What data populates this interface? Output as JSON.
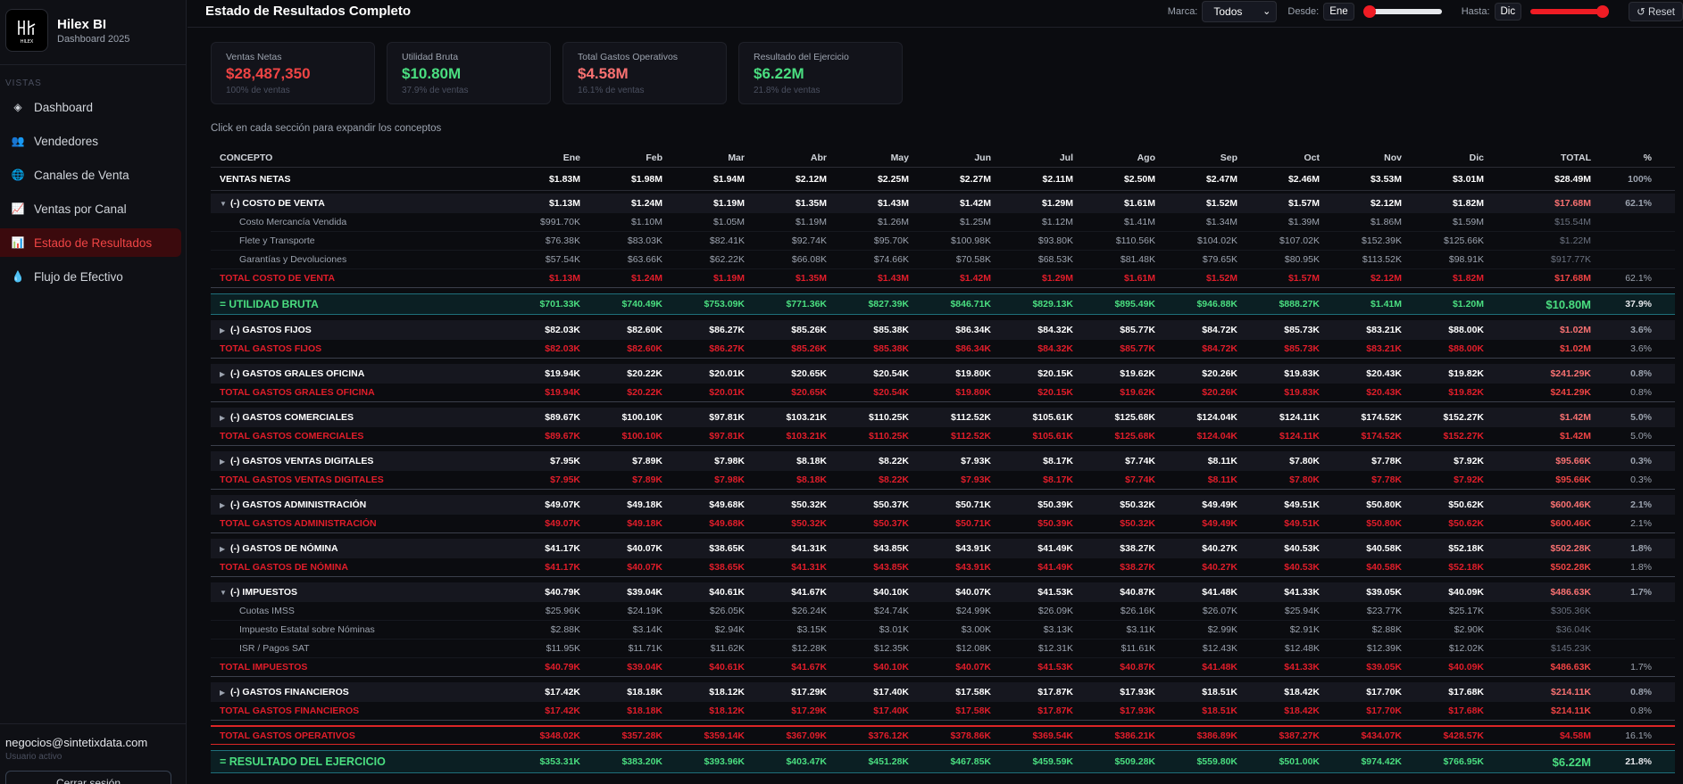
{
  "colors": {
    "accent": "#ef4444",
    "positive": "#4ade80",
    "active_bg": "#3b0a0d"
  },
  "sidebar": {
    "brand_title": "Hilex BI",
    "brand_subtitle": "Dashboard 2025",
    "logo_text": "HILEX",
    "section_label": "VISTAS",
    "items": [
      {
        "label": "Dashboard",
        "icon": "diamond-icon"
      },
      {
        "label": "Vendedores",
        "icon": "users-icon"
      },
      {
        "label": "Canales de Venta",
        "icon": "globe-icon"
      },
      {
        "label": "Ventas por Canal",
        "icon": "trend-chart-icon"
      },
      {
        "label": "Estado de Resultados",
        "icon": "bar-chart-icon",
        "active": true
      },
      {
        "label": "Flujo de Efectivo",
        "icon": "droplet-icon"
      }
    ],
    "user_email": "negocios@sintetixdata.com",
    "user_status": "Usuario activo",
    "logout_label": "Cerrar sesión"
  },
  "header": {
    "title": "Estado de Resultados Completo",
    "marca_label": "Marca:",
    "marca_value": "Todos",
    "desde_label": "Desde:",
    "desde_value": "Ene",
    "hasta_label": "Hasta:",
    "hasta_value": "Dic",
    "desde_slider_value": 0,
    "hasta_slider_value": 1,
    "reset_label": "↺ Reset"
  },
  "kpis": [
    {
      "label": "Ventas Netas",
      "value": "$28,487,350",
      "sub": "100% de ventas",
      "color": "#ef4444"
    },
    {
      "label": "Utilidad Bruta",
      "value": "$10.80M",
      "sub": "37.9% de ventas",
      "color": "#4ade80"
    },
    {
      "label": "Total Gastos Operativos",
      "value": "$4.58M",
      "sub": "16.1% de ventas",
      "color": "#f87171"
    },
    {
      "label": "Resultado del Ejercicio",
      "value": "$6.22M",
      "sub": "21.8% de ventas",
      "color": "#4ade80"
    }
  ],
  "hint": "Click en cada sección para expandir los conceptos",
  "table": {
    "headers": [
      "CONCEPTO",
      "Ene",
      "Feb",
      "Mar",
      "Abr",
      "May",
      "Jun",
      "Jul",
      "Ago",
      "Sep",
      "Oct",
      "Nov",
      "Dic",
      "TOTAL",
      "%"
    ],
    "rows": [
      {
        "type": "ventas",
        "label": "VENTAS NETAS",
        "values": [
          "$1.83M",
          "$1.98M",
          "$1.94M",
          "$2.12M",
          "$2.25M",
          "$2.27M",
          "$2.11M",
          "$2.50M",
          "$2.47M",
          "$2.46M",
          "$3.53M",
          "$3.01M"
        ],
        "total": "$28.49M",
        "pct": "100%"
      },
      {
        "type": "sec",
        "expanded": true,
        "label": "(-) COSTO DE VENTA",
        "values": [
          "$1.13M",
          "$1.24M",
          "$1.19M",
          "$1.35M",
          "$1.43M",
          "$1.42M",
          "$1.29M",
          "$1.61M",
          "$1.52M",
          "$1.57M",
          "$2.12M",
          "$1.82M"
        ],
        "total": "$17.68M",
        "pct": "62.1%"
      },
      {
        "type": "detail",
        "label": "Costo Mercancía Vendida",
        "values": [
          "$991.70K",
          "$1.10M",
          "$1.05M",
          "$1.19M",
          "$1.26M",
          "$1.25M",
          "$1.12M",
          "$1.41M",
          "$1.34M",
          "$1.39M",
          "$1.86M",
          "$1.59M"
        ],
        "total": "$15.54M",
        "pct": ""
      },
      {
        "type": "detail",
        "label": "Flete y Transporte",
        "values": [
          "$76.38K",
          "$83.03K",
          "$82.41K",
          "$92.74K",
          "$95.70K",
          "$100.98K",
          "$93.80K",
          "$110.56K",
          "$104.02K",
          "$107.02K",
          "$152.39K",
          "$125.66K"
        ],
        "total": "$1.22M",
        "pct": ""
      },
      {
        "type": "detail",
        "label": "Garantías y Devoluciones",
        "values": [
          "$57.54K",
          "$63.66K",
          "$62.22K",
          "$66.08K",
          "$74.66K",
          "$70.58K",
          "$68.53K",
          "$81.48K",
          "$79.65K",
          "$80.95K",
          "$113.52K",
          "$98.91K"
        ],
        "total": "$917.77K",
        "pct": ""
      },
      {
        "type": "total",
        "label": "TOTAL COSTO DE VENTA",
        "values": [
          "$1.13M",
          "$1.24M",
          "$1.19M",
          "$1.35M",
          "$1.43M",
          "$1.42M",
          "$1.29M",
          "$1.61M",
          "$1.52M",
          "$1.57M",
          "$2.12M",
          "$1.82M"
        ],
        "total": "$17.68M",
        "pct": "62.1%"
      },
      {
        "type": "util",
        "label": "= UTILIDAD BRUTA",
        "values": [
          "$701.33K",
          "$740.49K",
          "$753.09K",
          "$771.36K",
          "$827.39K",
          "$846.71K",
          "$829.13K",
          "$895.49K",
          "$946.88K",
          "$888.27K",
          "$1.41M",
          "$1.20M"
        ],
        "total": "$10.80M",
        "pct": "37.9%"
      },
      {
        "type": "sec",
        "label": "(-) GASTOS FIJOS",
        "values": [
          "$82.03K",
          "$82.60K",
          "$86.27K",
          "$85.26K",
          "$85.38K",
          "$86.34K",
          "$84.32K",
          "$85.77K",
          "$84.72K",
          "$85.73K",
          "$83.21K",
          "$88.00K"
        ],
        "total": "$1.02M",
        "pct": "3.6%"
      },
      {
        "type": "total",
        "label": "TOTAL GASTOS FIJOS",
        "values": [
          "$82.03K",
          "$82.60K",
          "$86.27K",
          "$85.26K",
          "$85.38K",
          "$86.34K",
          "$84.32K",
          "$85.77K",
          "$84.72K",
          "$85.73K",
          "$83.21K",
          "$88.00K"
        ],
        "total": "$1.02M",
        "pct": "3.6%"
      },
      {
        "type": "sec",
        "label": "(-) GASTOS GRALES OFICINA",
        "values": [
          "$19.94K",
          "$20.22K",
          "$20.01K",
          "$20.65K",
          "$20.54K",
          "$19.80K",
          "$20.15K",
          "$19.62K",
          "$20.26K",
          "$19.83K",
          "$20.43K",
          "$19.82K"
        ],
        "total": "$241.29K",
        "pct": "0.8%"
      },
      {
        "type": "total",
        "label": "TOTAL GASTOS GRALES OFICINA",
        "values": [
          "$19.94K",
          "$20.22K",
          "$20.01K",
          "$20.65K",
          "$20.54K",
          "$19.80K",
          "$20.15K",
          "$19.62K",
          "$20.26K",
          "$19.83K",
          "$20.43K",
          "$19.82K"
        ],
        "total": "$241.29K",
        "pct": "0.8%"
      },
      {
        "type": "sec",
        "label": "(-) GASTOS COMERCIALES",
        "values": [
          "$89.67K",
          "$100.10K",
          "$97.81K",
          "$103.21K",
          "$110.25K",
          "$112.52K",
          "$105.61K",
          "$125.68K",
          "$124.04K",
          "$124.11K",
          "$174.52K",
          "$152.27K"
        ],
        "total": "$1.42M",
        "pct": "5.0%"
      },
      {
        "type": "total",
        "label": "TOTAL GASTOS COMERCIALES",
        "values": [
          "$89.67K",
          "$100.10K",
          "$97.81K",
          "$103.21K",
          "$110.25K",
          "$112.52K",
          "$105.61K",
          "$125.68K",
          "$124.04K",
          "$124.11K",
          "$174.52K",
          "$152.27K"
        ],
        "total": "$1.42M",
        "pct": "5.0%"
      },
      {
        "type": "sec",
        "label": "(-) GASTOS VENTAS DIGITALES",
        "values": [
          "$7.95K",
          "$7.89K",
          "$7.98K",
          "$8.18K",
          "$8.22K",
          "$7.93K",
          "$8.17K",
          "$7.74K",
          "$8.11K",
          "$7.80K",
          "$7.78K",
          "$7.92K"
        ],
        "total": "$95.66K",
        "pct": "0.3%"
      },
      {
        "type": "total",
        "label": "TOTAL GASTOS VENTAS DIGITALES",
        "values": [
          "$7.95K",
          "$7.89K",
          "$7.98K",
          "$8.18K",
          "$8.22K",
          "$7.93K",
          "$8.17K",
          "$7.74K",
          "$8.11K",
          "$7.80K",
          "$7.78K",
          "$7.92K"
        ],
        "total": "$95.66K",
        "pct": "0.3%"
      },
      {
        "type": "sec",
        "label": "(-) GASTOS ADMINISTRACIÓN",
        "values": [
          "$49.07K",
          "$49.18K",
          "$49.68K",
          "$50.32K",
          "$50.37K",
          "$50.71K",
          "$50.39K",
          "$50.32K",
          "$49.49K",
          "$49.51K",
          "$50.80K",
          "$50.62K"
        ],
        "total": "$600.46K",
        "pct": "2.1%"
      },
      {
        "type": "total",
        "label": "TOTAL GASTOS ADMINISTRACIÓN",
        "values": [
          "$49.07K",
          "$49.18K",
          "$49.68K",
          "$50.32K",
          "$50.37K",
          "$50.71K",
          "$50.39K",
          "$50.32K",
          "$49.49K",
          "$49.51K",
          "$50.80K",
          "$50.62K"
        ],
        "total": "$600.46K",
        "pct": "2.1%"
      },
      {
        "type": "sec",
        "label": "(-) GASTOS DE NÓMINA",
        "values": [
          "$41.17K",
          "$40.07K",
          "$38.65K",
          "$41.31K",
          "$43.85K",
          "$43.91K",
          "$41.49K",
          "$38.27K",
          "$40.27K",
          "$40.53K",
          "$40.58K",
          "$52.18K"
        ],
        "total": "$502.28K",
        "pct": "1.8%"
      },
      {
        "type": "total",
        "label": "TOTAL GASTOS DE NÓMINA",
        "values": [
          "$41.17K",
          "$40.07K",
          "$38.65K",
          "$41.31K",
          "$43.85K",
          "$43.91K",
          "$41.49K",
          "$38.27K",
          "$40.27K",
          "$40.53K",
          "$40.58K",
          "$52.18K"
        ],
        "total": "$502.28K",
        "pct": "1.8%"
      },
      {
        "type": "sec",
        "expanded": true,
        "label": "(-) IMPUESTOS",
        "values": [
          "$40.79K",
          "$39.04K",
          "$40.61K",
          "$41.67K",
          "$40.10K",
          "$40.07K",
          "$41.53K",
          "$40.87K",
          "$41.48K",
          "$41.33K",
          "$39.05K",
          "$40.09K"
        ],
        "total": "$486.63K",
        "pct": "1.7%"
      },
      {
        "type": "detail",
        "label": "Cuotas IMSS",
        "values": [
          "$25.96K",
          "$24.19K",
          "$26.05K",
          "$26.24K",
          "$24.74K",
          "$24.99K",
          "$26.09K",
          "$26.16K",
          "$26.07K",
          "$25.94K",
          "$23.77K",
          "$25.17K"
        ],
        "total": "$305.36K",
        "pct": ""
      },
      {
        "type": "detail",
        "label": "Impuesto Estatal sobre Nóminas",
        "values": [
          "$2.88K",
          "$3.14K",
          "$2.94K",
          "$3.15K",
          "$3.01K",
          "$3.00K",
          "$3.13K",
          "$3.11K",
          "$2.99K",
          "$2.91K",
          "$2.88K",
          "$2.90K"
        ],
        "total": "$36.04K",
        "pct": ""
      },
      {
        "type": "detail",
        "label": "ISR / Pagos SAT",
        "values": [
          "$11.95K",
          "$11.71K",
          "$11.62K",
          "$12.28K",
          "$12.35K",
          "$12.08K",
          "$12.31K",
          "$11.61K",
          "$12.43K",
          "$12.48K",
          "$12.39K",
          "$12.02K"
        ],
        "total": "$145.23K",
        "pct": ""
      },
      {
        "type": "total",
        "label": "TOTAL IMPUESTOS",
        "values": [
          "$40.79K",
          "$39.04K",
          "$40.61K",
          "$41.67K",
          "$40.10K",
          "$40.07K",
          "$41.53K",
          "$40.87K",
          "$41.48K",
          "$41.33K",
          "$39.05K",
          "$40.09K"
        ],
        "total": "$486.63K",
        "pct": "1.7%"
      },
      {
        "type": "sec",
        "label": "(-) GASTOS FINANCIEROS",
        "values": [
          "$17.42K",
          "$18.18K",
          "$18.12K",
          "$17.29K",
          "$17.40K",
          "$17.58K",
          "$17.87K",
          "$17.93K",
          "$18.51K",
          "$18.42K",
          "$17.70K",
          "$17.68K"
        ],
        "total": "$214.11K",
        "pct": "0.8%"
      },
      {
        "type": "total",
        "label": "TOTAL GASTOS FINANCIEROS",
        "values": [
          "$17.42K",
          "$18.18K",
          "$18.12K",
          "$17.29K",
          "$17.40K",
          "$17.58K",
          "$17.87K",
          "$17.93K",
          "$18.51K",
          "$18.42K",
          "$17.70K",
          "$17.68K"
        ],
        "total": "$214.11K",
        "pct": "0.8%"
      },
      {
        "type": "ops",
        "label": "TOTAL GASTOS OPERATIVOS",
        "values": [
          "$348.02K",
          "$357.28K",
          "$359.14K",
          "$367.09K",
          "$376.12K",
          "$378.86K",
          "$369.54K",
          "$386.21K",
          "$386.89K",
          "$387.27K",
          "$434.07K",
          "$428.57K"
        ],
        "total": "$4.58M",
        "pct": "16.1%"
      },
      {
        "type": "res",
        "label": "= RESULTADO DEL EJERCICIO",
        "values": [
          "$353.31K",
          "$383.20K",
          "$393.96K",
          "$403.47K",
          "$451.28K",
          "$467.85K",
          "$459.59K",
          "$509.28K",
          "$559.80K",
          "$501.00K",
          "$974.42K",
          "$766.95K"
        ],
        "total": "$6.22M",
        "pct": "21.8%"
      }
    ]
  }
}
